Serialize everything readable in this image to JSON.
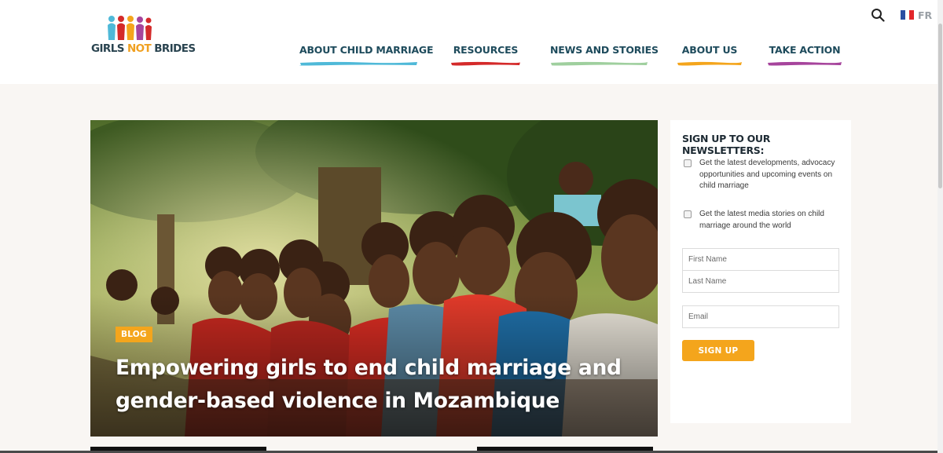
{
  "brand": {
    "logo_word_1": "GIRLS",
    "logo_word_2": "NOT",
    "logo_word_3": "BRIDES",
    "colors": {
      "orange": "#f4a51c",
      "navy": "#1e4b5c"
    }
  },
  "header": {
    "search_icon": "search-icon",
    "language": {
      "code": "FR",
      "flag_icon": "french-flag-icon"
    }
  },
  "nav": [
    {
      "label": "ABOUT CHILD MARRIAGE",
      "color": "#4fb9d8"
    },
    {
      "label": "RESOURCES",
      "color": "#d42a2a"
    },
    {
      "label": "NEWS AND STORIES",
      "color": "#9fcf9e"
    },
    {
      "label": "ABOUT US",
      "color": "#f4a51c"
    },
    {
      "label": "TAKE ACTION",
      "color": "#a6449c"
    }
  ],
  "hero": {
    "badge": "BLOG",
    "title": "Empowering girls to end child marriage and gender-based violence in Mozambique"
  },
  "newsletter": {
    "title": "SIGN UP TO OUR NEWSLETTERS:",
    "options": [
      "Get the latest developments, advocacy opportunities and upcoming events on child marriage",
      "Get the latest media stories on child marriage around the world"
    ],
    "first_name_placeholder": "First Name",
    "last_name_placeholder": "Last Name",
    "email_placeholder": "Email",
    "submit_label": "SIGN UP"
  }
}
